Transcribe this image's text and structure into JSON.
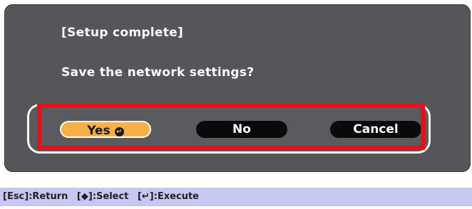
{
  "dialog": {
    "title": "[Setup complete]",
    "message": "Save the network settings?",
    "buttons": {
      "yes_label": "Yes",
      "no_label": "No",
      "cancel_label": "Cancel"
    },
    "enter_icon_glyph": "↵"
  },
  "status_bar": {
    "hints": [
      {
        "key": "[Esc]",
        "action": ":Return"
      },
      {
        "key": "[◆]",
        "action": ":Select"
      },
      {
        "key": "[↵]",
        "action": ":Execute"
      }
    ]
  },
  "colors": {
    "dialog_background": "#555659",
    "selected_button": "#f7b046",
    "unselected_button": "#0a0a0a",
    "highlight_border": "#e4101a",
    "status_bar_background": "#c6c8f2"
  },
  "icons": {
    "enter": "enter-key-icon",
    "select": "arrow-keys-icon",
    "execute": "enter-key-icon"
  }
}
